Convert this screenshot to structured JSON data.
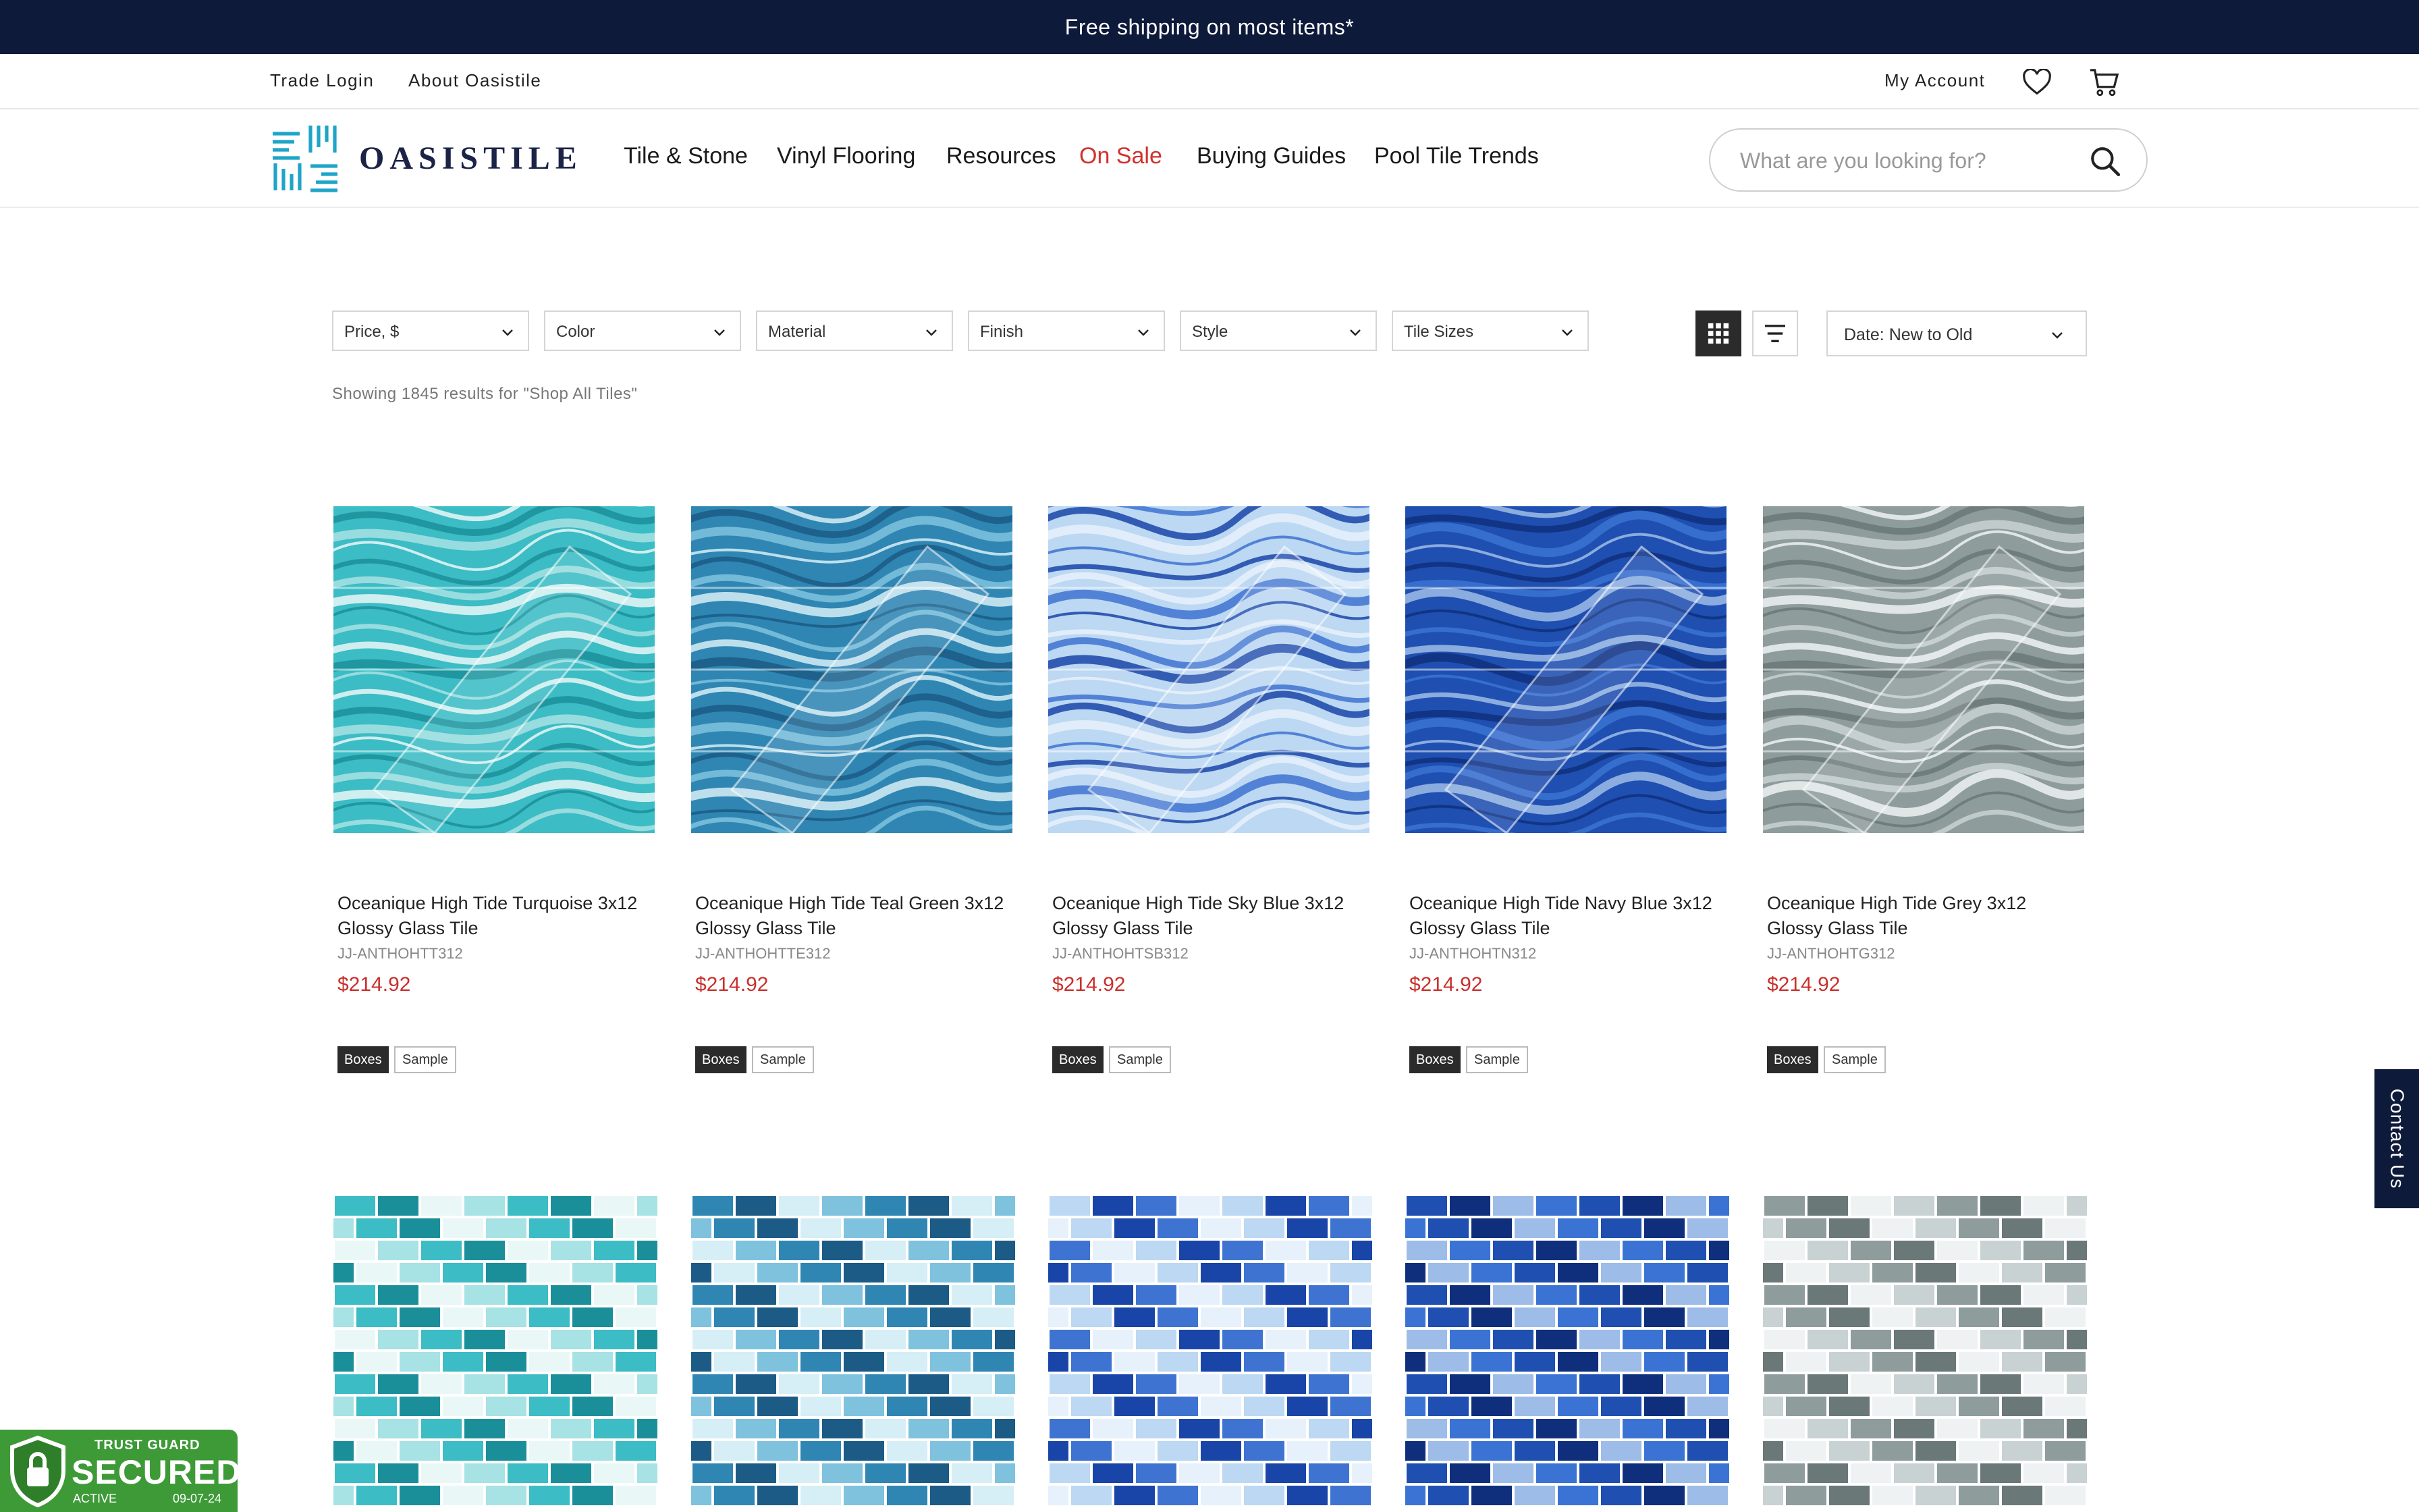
{
  "announcement": {
    "text": "Free shipping on most items*"
  },
  "utility": {
    "trade_login": "Trade Login",
    "about": "About Oasistile",
    "account": "My Account"
  },
  "brand": {
    "name": "OASISTILE",
    "color": "#1b2447",
    "accent": "#1fa5c8"
  },
  "nav": {
    "items": [
      {
        "label": "Tile & Stone"
      },
      {
        "label": "Vinyl Flooring"
      },
      {
        "label": "Resources"
      },
      {
        "label": "On Sale"
      },
      {
        "label": "Buying Guides"
      },
      {
        "label": "Pool Tile Trends"
      }
    ],
    "sale_color": "#d0312d"
  },
  "search": {
    "placeholder": "What are you looking for?"
  },
  "filters": [
    {
      "label": "Price, $"
    },
    {
      "label": "Color"
    },
    {
      "label": "Material"
    },
    {
      "label": "Finish"
    },
    {
      "label": "Style"
    },
    {
      "label": "Tile Sizes"
    }
  ],
  "sort": {
    "selected": "Date: New to Old"
  },
  "results": {
    "text": "Showing 1845 results for \"Shop All Tiles\""
  },
  "products": [
    {
      "title": "Oceanique High Tide Turquoise 3x12 Glossy Glass Tile",
      "sku": "JJ-ANTHOHTT312",
      "price": "$214.92",
      "boxes": "Boxes",
      "sample": "Sample",
      "colors": [
        "#3cbcc4",
        "#a7e2e4",
        "#e9f7f7",
        "#1a8f9a"
      ]
    },
    {
      "title": "Oceanique High Tide Teal Green 3x12 Glossy Glass Tile",
      "sku": "JJ-ANTHOHTTE312",
      "price": "$214.92",
      "boxes": "Boxes",
      "sample": "Sample",
      "colors": [
        "#2f86b3",
        "#7fc2de",
        "#d6eef6",
        "#1b5b85"
      ]
    },
    {
      "title": "Oceanique High Tide Sky Blue 3x12 Glossy Glass Tile",
      "sku": "JJ-ANTHOHTSB312",
      "price": "$214.92",
      "boxes": "Boxes",
      "sample": "Sample",
      "colors": [
        "#bcd8f2",
        "#e7f1fb",
        "#3f73d1",
        "#1a45a8"
      ]
    },
    {
      "title": "Oceanique High Tide Navy Blue 3x12 Glossy Glass Tile",
      "sku": "JJ-ANTHOHTN312",
      "price": "$214.92",
      "boxes": "Boxes",
      "sample": "Sample",
      "colors": [
        "#1f4fb0",
        "#3b73d4",
        "#9dbce8",
        "#0f2f7d"
      ]
    },
    {
      "title": "Oceanique High Tide Grey 3x12 Glossy Glass Tile",
      "sku": "JJ-ANTHOHTG312",
      "price": "$214.92",
      "boxes": "Boxes",
      "sample": "Sample",
      "colors": [
        "#8f9c9c",
        "#c9d2d2",
        "#eef2f2",
        "#6b7878"
      ]
    }
  ],
  "contact": {
    "label": "Contact Us"
  },
  "trust_badge": {
    "top": "TRUST GUARD",
    "main": "SECURED",
    "status": "ACTIVE",
    "date": "09-07-24"
  }
}
